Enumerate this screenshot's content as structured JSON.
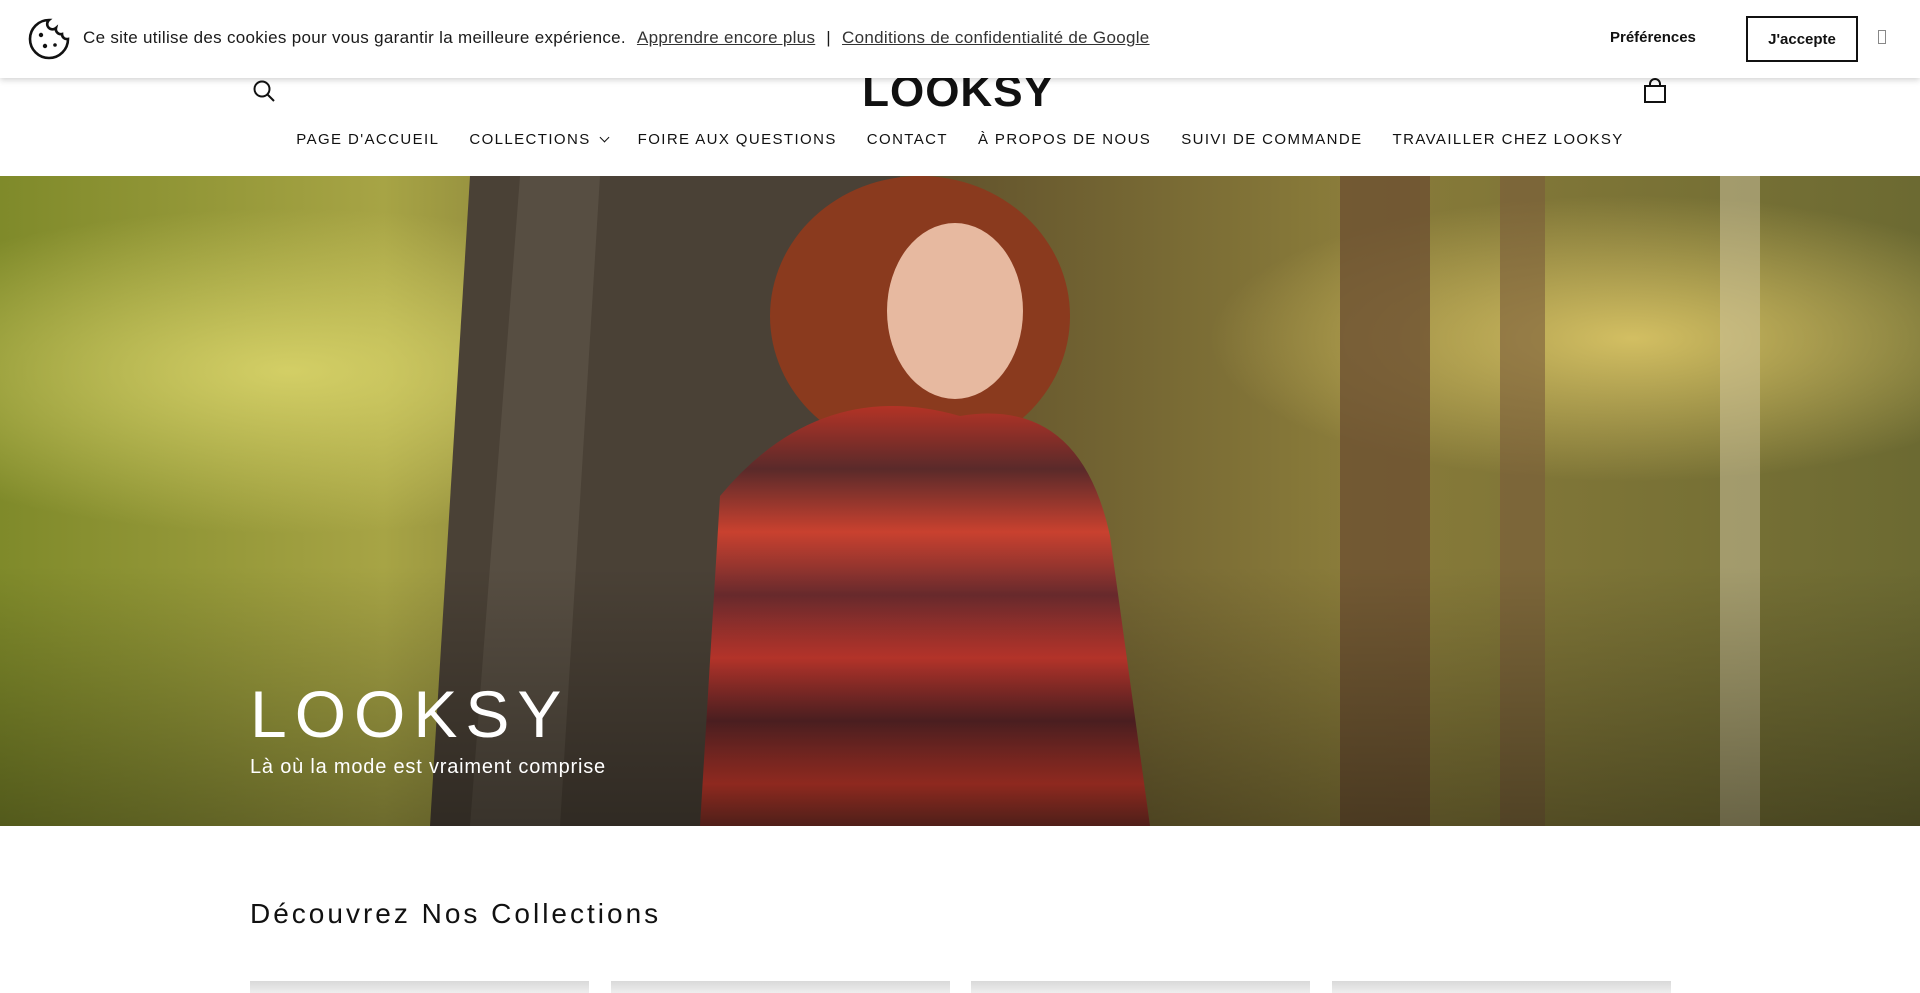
{
  "cookie_bar": {
    "message": "Ce site utilise des cookies pour vous garantir la meilleure expérience.",
    "learn_more": "Apprendre encore plus",
    "separator": "|",
    "privacy_link": "Conditions de confidentialité de Google",
    "preferences_label": "Préférences",
    "accept_label": "J'accepte"
  },
  "header": {
    "logo_text": "LOOKSY",
    "nav": [
      {
        "label": "PAGE D'ACCUEIL"
      },
      {
        "label": "COLLECTIONS",
        "has_dropdown": true
      },
      {
        "label": "FOIRE AUX QUESTIONS"
      },
      {
        "label": "CONTACT"
      },
      {
        "label": "À PROPOS DE NOUS"
      },
      {
        "label": "SUIVI DE COMMANDE"
      },
      {
        "label": "TRAVAILLER CHEZ LOOKSY"
      }
    ]
  },
  "hero": {
    "title": "LOOKSY",
    "subtitle": "Là où la mode est vraiment comprise"
  },
  "collections": {
    "heading": "Découvrez Nos Collections"
  }
}
